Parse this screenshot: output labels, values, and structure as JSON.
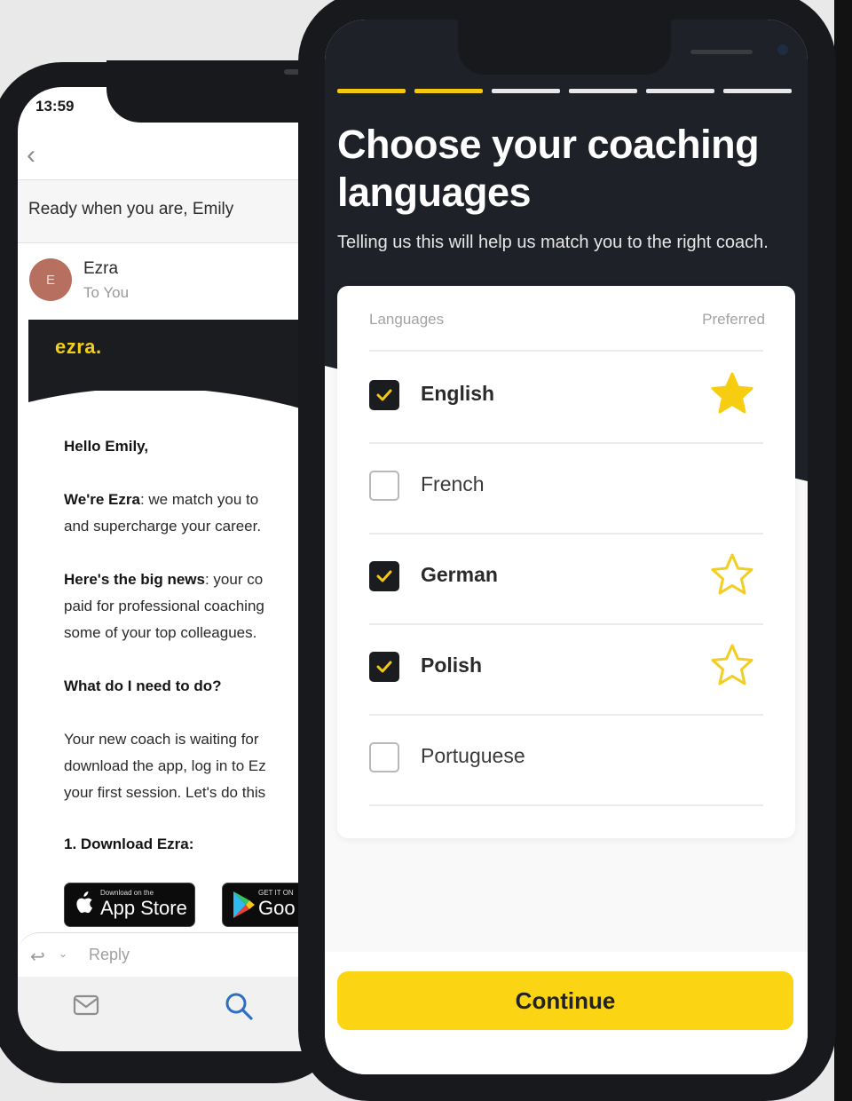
{
  "email_app": {
    "status_time": "13:59",
    "back_icon": "‹",
    "subject": "Ready when you are, Emily",
    "sender": {
      "avatar_initial": "E",
      "name": "Ezra",
      "recipient": "To You",
      "avatar_color": "#b76f5f"
    },
    "brand_logo": "ezra.",
    "body": {
      "greeting": "Hello Emily,",
      "p1_bold": "We're Ezra",
      "p1_rest": ": we match you to",
      "p1_line2": "and supercharge your career.",
      "p2_bold": "Here's the big news",
      "p2_rest": ": your co",
      "p2_line2": "paid for professional coaching",
      "p2_line3": "some of your top colleagues.",
      "heading": "What do I need to do?",
      "p3_line1": "Your new coach is waiting for",
      "p3_line2": "download the app, log in to Ez",
      "p3_line3": "your first session. Let's do this",
      "step1": "1. Download Ezra:"
    },
    "store_buttons": {
      "app_store_small": "Download on the",
      "app_store_big": "App Store",
      "google_play_small": "GET IT ON",
      "google_play_big": "Goo"
    },
    "reply_label": "Reply",
    "tabs": [
      "mail-icon",
      "search-icon"
    ]
  },
  "onboarding": {
    "progress": {
      "total_steps": 6,
      "completed_steps": 2
    },
    "title": "Choose your coaching languages",
    "subtitle": "Telling us this will help us match you to the right coach.",
    "table_headers": {
      "languages": "Languages",
      "preferred": "Preferred"
    },
    "languages": [
      {
        "name": "English",
        "checked": true,
        "preferred": true
      },
      {
        "name": "French",
        "checked": false,
        "preferred": false
      },
      {
        "name": "German",
        "checked": true,
        "preferred": false
      },
      {
        "name": "Polish",
        "checked": true,
        "preferred": false
      },
      {
        "name": "Portuguese",
        "checked": false,
        "preferred": false
      }
    ],
    "continue_label": "Continue",
    "colors": {
      "accent": "#fbd514",
      "dark": "#1f2128"
    }
  }
}
